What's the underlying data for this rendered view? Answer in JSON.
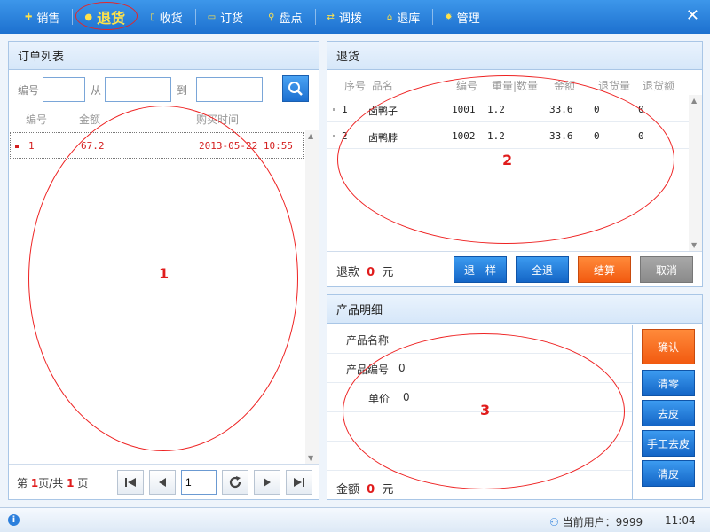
{
  "nav": {
    "items": [
      {
        "label": "销售"
      },
      {
        "label": "退货"
      },
      {
        "label": "收货"
      },
      {
        "label": "订货"
      },
      {
        "label": "盘点"
      },
      {
        "label": "调拨"
      },
      {
        "label": "退库"
      },
      {
        "label": "管理"
      }
    ],
    "close": "✕"
  },
  "orders": {
    "title": "订单列表",
    "search": {
      "label_no": "编号",
      "label_from": "从",
      "label_to": "到"
    },
    "columns": {
      "no": "编号",
      "amount": "金额",
      "time": "购买时间"
    },
    "rows": [
      {
        "no": "1",
        "amount": "67.2",
        "time": "2013-05-22 10:55"
      }
    ],
    "pager": {
      "prefix": "第",
      "page": "1",
      "mid": "页/共",
      "total": "1",
      "suffix": "页",
      "input": "1"
    }
  },
  "returns": {
    "title": "退货",
    "columns": {
      "seq": "序号",
      "name": "品名",
      "code": "编号",
      "weight": "重量|数量",
      "amount": "金额",
      "qty": "退货量",
      "ret_amount": "退货额"
    },
    "rows": [
      {
        "seq": "1",
        "name": "卤鸭子",
        "code": "1001",
        "weight": "1.2",
        "amount": "33.6",
        "qty": "0",
        "ret_amount": "0"
      },
      {
        "seq": "2",
        "name": "卤鸭脖",
        "code": "1002",
        "weight": "1.2",
        "amount": "33.6",
        "qty": "0",
        "ret_amount": "0"
      }
    ],
    "refund": {
      "label": "退款",
      "value": "0",
      "unit": "元"
    },
    "buttons": {
      "return_same": "退一样",
      "return_all": "全退",
      "settle": "结算",
      "cancel": "取消"
    }
  },
  "detail": {
    "title": "产品明细",
    "fields": {
      "name_label": "产品名称",
      "name_value": "",
      "code_label": "产品编号",
      "code_value": "0",
      "price_label": "单价",
      "price_value": "0"
    },
    "total": {
      "label": "金额",
      "value": "0",
      "unit": "元"
    },
    "buttons": {
      "confirm": "确认",
      "clear_zero": "清零",
      "tare": "去皮",
      "manual_tare": "手工去皮",
      "clear_tare": "清皮"
    }
  },
  "annotations": [
    "1",
    "2",
    "3"
  ],
  "status": {
    "user_label": "当前用户：",
    "user": "9999",
    "time": "11:04"
  },
  "colors": {
    "topbar": "#1d71cf",
    "accent_red": "#e01c1c",
    "button_blue": "#1465c6",
    "button_orange": "#f25a10",
    "button_gray": "#8a8a8a"
  }
}
